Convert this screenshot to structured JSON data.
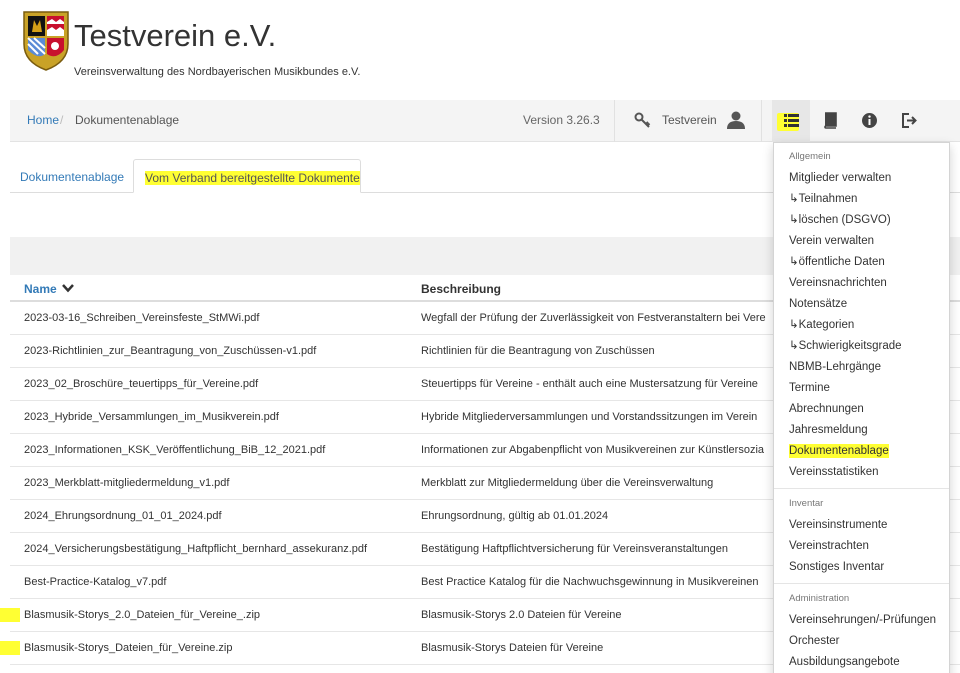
{
  "brand": {
    "title": "Testverein e.V.",
    "subtitle": "Vereinsverwaltung des Nordbayerischen Musikbundes e.V."
  },
  "navbar": {
    "breadcrumb_home": "Home",
    "breadcrumb_separator": "/",
    "breadcrumb_current": "Dokumentenablage",
    "version": "Version 3.26.3",
    "club_name": "Testverein",
    "icons": [
      "key-icon",
      "user-icon",
      "list-icon",
      "book-icon",
      "info-icon",
      "logout-icon"
    ]
  },
  "tabs": [
    {
      "label": "Dokumentenablage",
      "active": false
    },
    {
      "label": "Vom Verband bereitgestellte Dokumente",
      "active": true
    }
  ],
  "table": {
    "headers": {
      "name": "Name",
      "description": "Beschreibung"
    },
    "rows": [
      {
        "name": "2023-03-16_Schreiben_Vereinsfeste_StMWi.pdf",
        "description": "Wegfall der Prüfung der Zuverlässigkeit von Festveranstaltern bei Vere"
      },
      {
        "name": "2023-Richtlinien_zur_Beantragung_von_Zuschüssen-v1.pdf",
        "description": "Richtlinien für die Beantragung von Zuschüssen"
      },
      {
        "name": "2023_02_Broschüre_teuertipps_für_Vereine.pdf",
        "description": "Steuertipps für Vereine - enthält auch eine Mustersatzung für Vereine"
      },
      {
        "name": "2023_Hybride_Versammlungen_im_Musikverein.pdf",
        "description": "Hybride Mitgliederversammlungen und Vorstandssitzungen im Verein"
      },
      {
        "name": "2023_Informationen_KSK_Veröffentlichung_BiB_12_2021.pdf",
        "description": "Informationen zur Abgabenpflicht von Musikvereinen zur Künstlersozia"
      },
      {
        "name": "2023_Merkblatt-mitgliedermeldung_v1.pdf",
        "description": "Merkblatt zur Mitgliedermeldung über die Vereinsverwaltung"
      },
      {
        "name": "2024_Ehrungsordnung_01_01_2024.pdf",
        "description": "Ehrungsordnung, gültig ab 01.01.2024"
      },
      {
        "name": "2024_Versicherungsbestätigung_Haftpflicht_bernhard_assekuranz.pdf",
        "description": "Bestätigung Haftpflichtversicherung für Vereinsveranstaltungen"
      },
      {
        "name": "Best-Practice-Katalog_v7.pdf",
        "description": "Best Practice Katalog für die Nachwuchsgewinnung in Musikvereinen"
      },
      {
        "name": "Blasmusik-Storys_2.0_Dateien_für_Vereine_.zip",
        "description": "Blasmusik-Storys 2.0 Dateien für Vereine",
        "marked": true
      },
      {
        "name": "Blasmusik-Storys_Dateien_für_Vereine.zip",
        "description": "Blasmusik-Storys Dateien für Vereine",
        "marked": true
      }
    ]
  },
  "menu": {
    "sections": [
      {
        "header": "Allgemein",
        "items": [
          "Mitglieder verwalten",
          "↳Teilnahmen",
          "↳löschen (DSGVO)",
          "Verein verwalten",
          "↳öffentliche Daten",
          "Vereinsnachrichten",
          "Notensätze",
          "↳Kategorien",
          "↳Schwierigkeitsgrade",
          "NBMB-Lehrgänge",
          "Termine",
          "Abrechnungen",
          "Jahresmeldung",
          "Dokumentenablage",
          "Vereinsstatistiken"
        ]
      },
      {
        "header": "Inventar",
        "items": [
          "Vereinsinstrumente",
          "Vereinstrachten",
          "Sonstiges Inventar"
        ]
      },
      {
        "header": "Administration",
        "items": [
          "Vereinsehrungen/-Prüfungen",
          "Orchester",
          "Ausbildungsangebote"
        ]
      }
    ]
  },
  "colors": {
    "link": "#337ab7",
    "highlight": "#ffff33",
    "navbar_bg": "#f4f4f4",
    "text": "#333333"
  }
}
